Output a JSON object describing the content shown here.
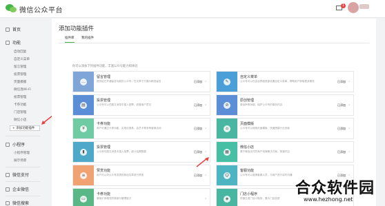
{
  "app": {
    "title": "微信公众平台"
  },
  "header": {
    "mail_badge": "1"
  },
  "sidebar": {
    "sections": [
      {
        "label": "首页",
        "icon": "home-icon"
      },
      {
        "label": "功能",
        "icon": "grid-icon"
      },
      {
        "label": "小程序",
        "icon": "link-icon"
      },
      {
        "label": "微信支付",
        "icon": "pay-icon"
      },
      {
        "label": "企业微信",
        "icon": "chat-icon"
      },
      {
        "label": "微信搜索",
        "icon": "search-icon"
      }
    ],
    "feature_items": [
      "自动回复",
      "自定义菜单",
      "留言管理",
      "投票管理",
      "页面模版",
      "微信连Wi-Fi",
      "投票管理",
      "卡券功能",
      "门店管理",
      "微信小店"
    ],
    "add_plugin_label": "+ 添加功能插件",
    "miniprogram_items": [
      "小程序管理",
      "展示场景"
    ]
  },
  "main": {
    "title": "添加功能插件",
    "tabs": [
      "插件库",
      "我的插件"
    ],
    "intro": "你可以添加下列插件功能，丰富公众号能力和体验"
  },
  "cards": [
    {
      "name": "留言管理",
      "desc": "提供给已开通留言功能的公众号，在文章下方展示精选留言",
      "status": "已添加",
      "color": "#7fa6d6",
      "icon": "comment-icon"
    },
    {
      "name": "自定义菜单",
      "desc": "公众号可以在会话界面底部设置自定义菜单，帮助用户获取更多服务",
      "status": "已添加",
      "color": "#4a9fd8",
      "icon": "edit-icon"
    },
    {
      "name": "投票管理",
      "desc": "公众号可以在图文消息中插入投票，收集用户意见",
      "status": "已添加",
      "color": "#5b8ed6",
      "icon": "vote-icon"
    },
    {
      "name": "原创管理",
      "desc": "原创声明功能，保护公众号的原创内容",
      "status": "已添加",
      "color": "#5b8ed6",
      "icon": "compass-icon"
    },
    {
      "name": "卡券功能",
      "desc": "商户可通过卡券功能，实现优惠券、会员卡等多种营销活动",
      "status": "已添加",
      "color": "#6fcba3",
      "icon": "coupon-icon"
    },
    {
      "name": "页面模版",
      "desc": "公众号可以使用页面模版，快速搭建行业页面",
      "status": "已添加",
      "color": "#48b6a0",
      "icon": "house-icon"
    },
    {
      "name": "投票管理",
      "desc": "公众号在图文消息中插入投票，统计结果数据",
      "status": "已添加",
      "color": "#4ea8c8",
      "icon": "chart-icon"
    },
    {
      "name": "微信小店",
      "desc": "基于微信支付的商户电商解决方案，快速开店",
      "status": "已添加",
      "color": "#46bfa5",
      "icon": "shop-icon"
    },
    {
      "name": "赞赏功能",
      "desc": "用户可以对公众号发表的原创文章进行赞赏",
      "status": "已添加",
      "color": "#f0a273",
      "icon": "reward-icon"
    },
    {
      "name": "客服功能",
      "desc": "公众号可以邀请客服人员，与用户进行实时沟通",
      "status": "已添加",
      "color": "#4db5c2",
      "icon": "service-icon"
    },
    {
      "name": "卡券功能",
      "desc": "营销卡券相关的核销与管理能力",
      "status": "",
      "color": "#5ab886",
      "icon": "card-icon"
    },
    {
      "name": "门店小程序",
      "desc": "快速生成门店小程序，展示门店信息",
      "status": "",
      "color": "#48b6a0",
      "icon": "store-icon"
    }
  ],
  "watermark": {
    "text": "合众软件园",
    "url": "www.hezhong.net"
  },
  "colors": {
    "accent": "#44b549",
    "annotation_arrow": "#e64340"
  }
}
